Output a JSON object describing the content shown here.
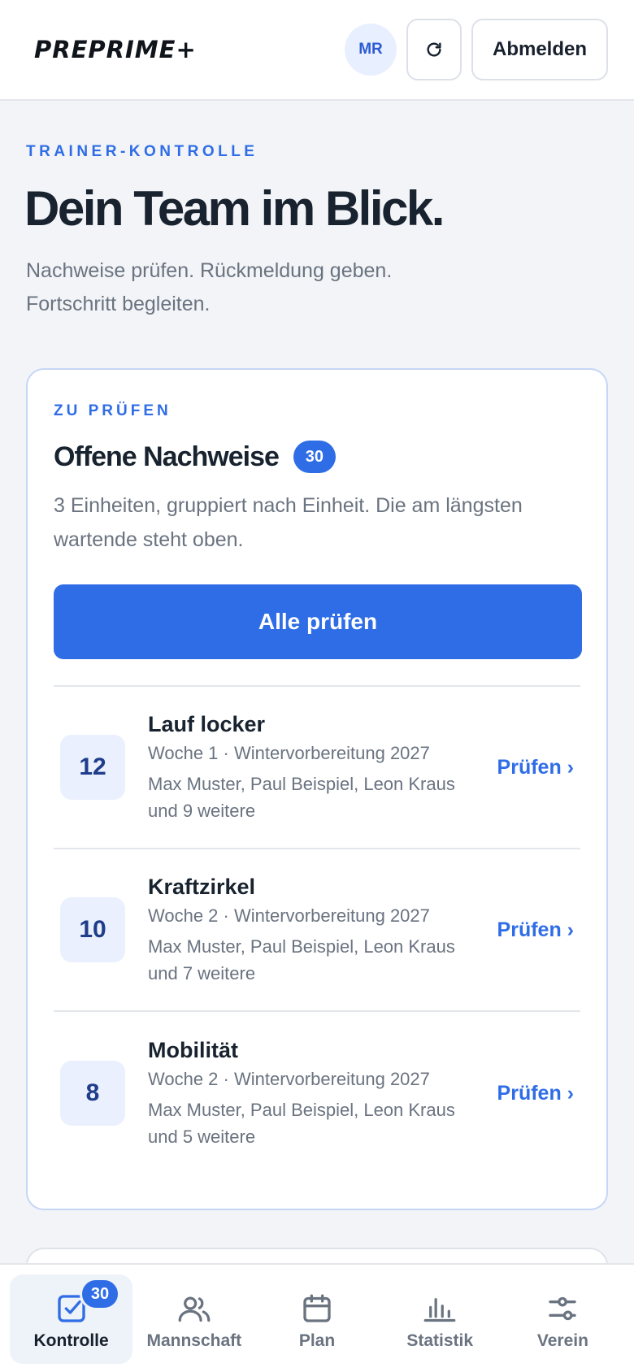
{
  "header": {
    "logo": "PREPRIME+",
    "avatar_initials": "MR",
    "refresh_icon": "refresh-icon",
    "logout_label": "Abmelden"
  },
  "hero": {
    "eyebrow": "TRAINER-KONTROLLE",
    "title": "Dein Team im Blick.",
    "subtitle": "Nachweise prüfen. Rückmeldung geben. Fortschritt begleiten."
  },
  "review": {
    "eyebrow": "ZU PRÜFEN",
    "title": "Offene Nachweise",
    "count": "30",
    "description": "3 Einheiten, gruppiert nach Einheit. Die am längsten wartende steht oben.",
    "primary_action": "Alle prüfen",
    "items": [
      {
        "count": "12",
        "title": "Lauf locker",
        "meta": "Woche 1 · Wintervorbereitung 2027",
        "names": "Max Muster, Paul Beispiel, Leon Kraus und 9 weitere",
        "action": "Prüfen ›"
      },
      {
        "count": "10",
        "title": "Kraftzirkel",
        "meta": "Woche 2 · Wintervorbereitung 2027",
        "names": "Max Muster, Paul Beispiel, Leon Kraus und 7 weitere",
        "action": "Prüfen ›"
      },
      {
        "count": "8",
        "title": "Mobilität",
        "meta": "Woche 2 · Wintervorbereitung 2027",
        "names": "Max Muster, Paul Beispiel, Leon Kraus und 5 weitere",
        "action": "Prüfen ›"
      }
    ]
  },
  "nav": {
    "items": [
      {
        "label": "Kontrolle",
        "icon": "checkbox-icon",
        "badge": "30",
        "active": true
      },
      {
        "label": "Mannschaft",
        "icon": "users-icon"
      },
      {
        "label": "Plan",
        "icon": "calendar-icon"
      },
      {
        "label": "Statistik",
        "icon": "bar-chart-icon"
      },
      {
        "label": "Verein",
        "icon": "sliders-icon"
      }
    ]
  },
  "colors": {
    "accent": "#2f6de6",
    "text": "#18232f",
    "muted": "#6a7380",
    "background": "#f2f4f7"
  }
}
